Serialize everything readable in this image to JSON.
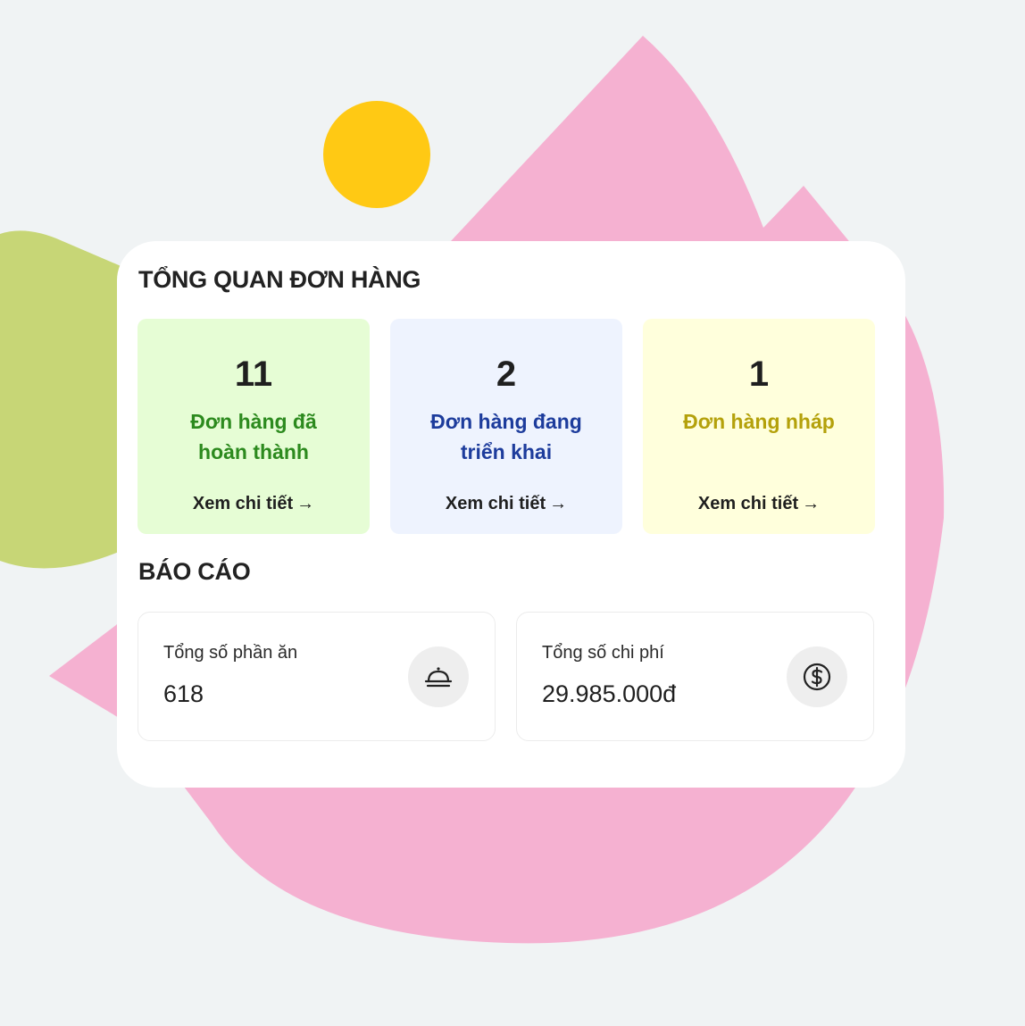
{
  "overview": {
    "title": "TỔNG QUAN ĐƠN HÀNG",
    "cards": [
      {
        "count": "11",
        "label": "Đơn hàng đã hoàn thành",
        "link": "Xem chi tiết",
        "accent": "#2c8a1e",
        "background": "#e6fdd5"
      },
      {
        "count": "2",
        "label": "Đơn hàng đang triển khai",
        "link": "Xem chi tiết",
        "accent": "#1d3c9c",
        "background": "#eef3fe"
      },
      {
        "count": "1",
        "label": "Đơn hàng nháp",
        "link": "Xem chi tiết",
        "accent": "#b4a10b",
        "background": "#ffffdc"
      }
    ],
    "link_arrow": "→"
  },
  "report": {
    "title": "BÁO CÁO",
    "items": [
      {
        "label": "Tổng số phần ăn",
        "value": "618",
        "icon": "food-cloche-icon"
      },
      {
        "label": "Tổng số chi phí",
        "value": "29.985.000đ",
        "icon": "dollar-circle-icon"
      }
    ]
  },
  "colors": {
    "page_background": "#f0f3f4",
    "pink_shape": "#f5b1d1",
    "green_shape": "#c7d676",
    "yellow_circle": "#ffc914"
  }
}
